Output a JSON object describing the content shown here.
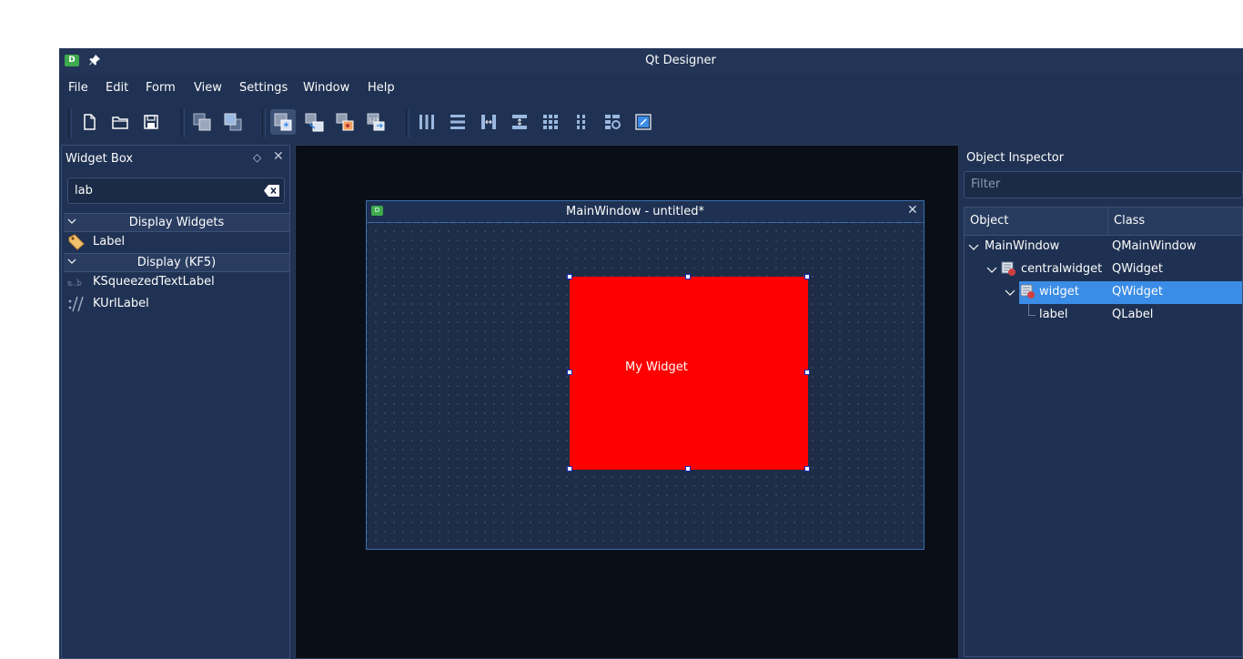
{
  "window": {
    "title": "Qt Designer",
    "app_icon_letter": "D"
  },
  "menubar": {
    "items": [
      "File",
      "Edit",
      "Form",
      "View",
      "Settings",
      "Window",
      "Help"
    ]
  },
  "toolbar": {
    "buttons": [
      "new-form-icon",
      "open-form-icon",
      "save-form-icon",
      "bring-to-front-icon",
      "send-to-back-icon",
      "edit-widgets-icon",
      "edit-signals-slots-icon",
      "edit-buddies-icon",
      "edit-tab-order-icon",
      "layout-horizontal-icon",
      "layout-vertical-icon",
      "layout-horizontal-splitter-icon",
      "layout-vertical-splitter-icon",
      "layout-grid-icon",
      "layout-form-icon",
      "break-layout-icon",
      "adjust-size-icon"
    ]
  },
  "widget_box": {
    "title": "Widget Box",
    "search_value": "lab",
    "categories": [
      {
        "label": "Display Widgets",
        "items": [
          {
            "label": "Label",
            "icon": "label-tag-icon"
          }
        ]
      },
      {
        "label": "Display (KF5)",
        "items": [
          {
            "label": "KSqueezedTextLabel",
            "icon": "squeezed-text-icon"
          },
          {
            "label": "KUrlLabel",
            "icon": "url-label-icon"
          }
        ]
      }
    ]
  },
  "form_window": {
    "title": "MainWindow - untitled*",
    "app_icon_letter": "D",
    "widget_label": "My Widget",
    "widget_color": "#ff0000"
  },
  "object_inspector": {
    "title": "Object Inspector",
    "filter_placeholder": "Filter",
    "columns": [
      "Object",
      "Class"
    ],
    "rows": [
      {
        "object": "MainWindow",
        "class": "QMainWindow",
        "selected": false
      },
      {
        "object": "centralwidget",
        "class": "QWidget",
        "selected": false
      },
      {
        "object": "widget",
        "class": "QWidget",
        "selected": true
      },
      {
        "object": "label",
        "class": "QLabel",
        "selected": false
      }
    ]
  },
  "colors": {
    "panel_bg": "#203253",
    "canvas_bg": "#0a0f17",
    "selection": "#3a8ce6",
    "accent_green": "#3daa4e"
  }
}
